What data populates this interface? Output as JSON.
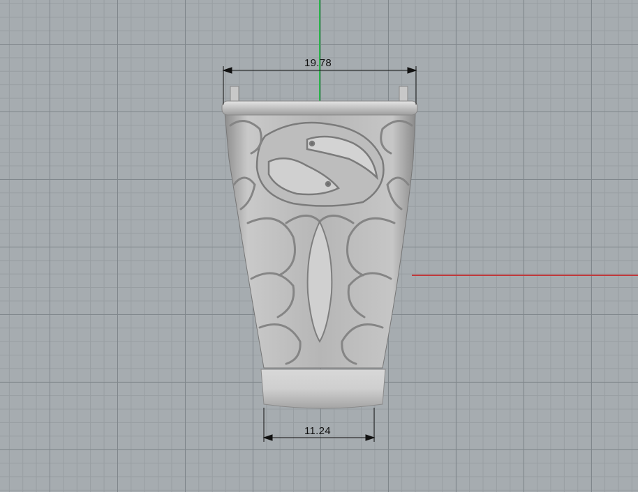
{
  "viewport": {
    "axis_colors": {
      "x": "#c0393b",
      "y": "#2bb24c"
    },
    "grid_color": "#7f868b"
  },
  "dimensions": {
    "top_width": "19.78",
    "bottom_width": "11.24"
  },
  "model": {
    "object": "ring",
    "material_color": "#c2c2c2"
  }
}
